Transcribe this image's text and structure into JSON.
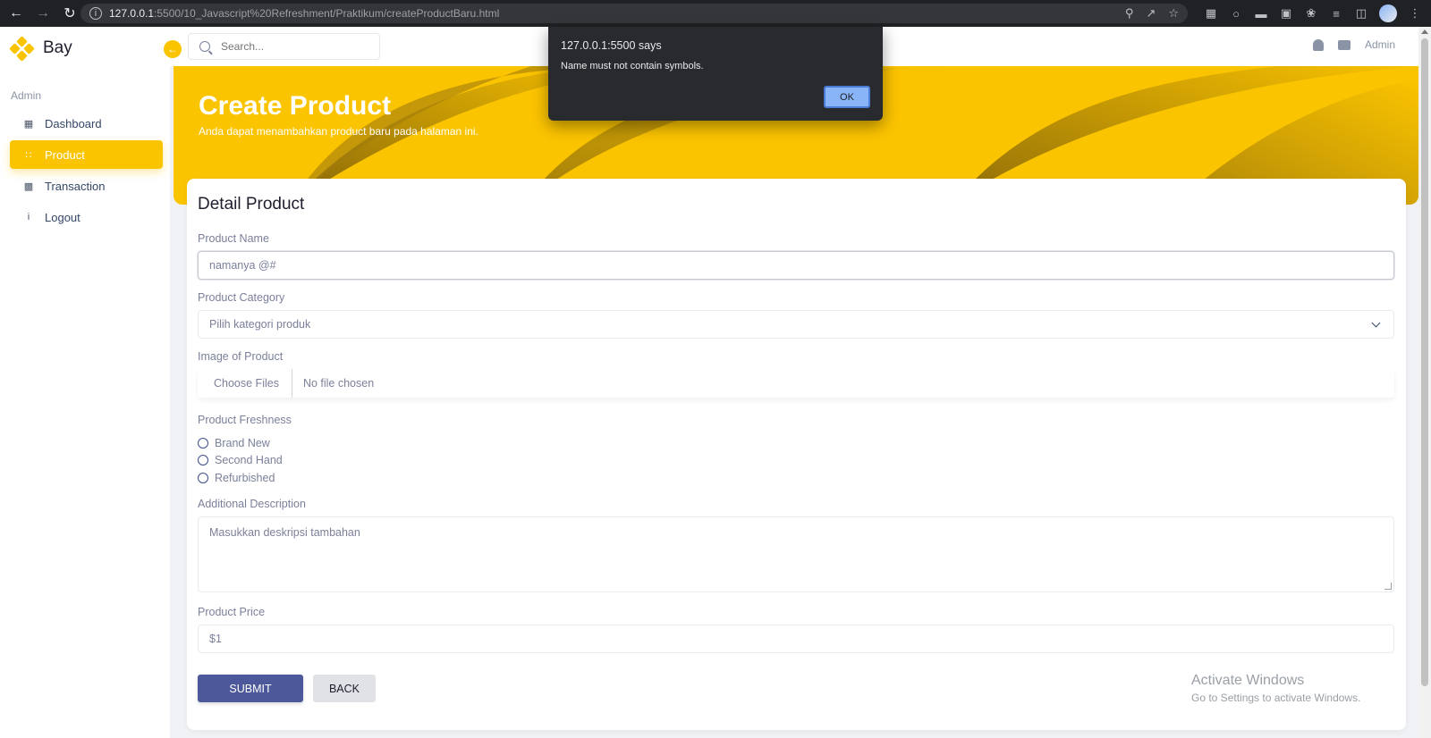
{
  "browser": {
    "url_host": "127.0.0.1",
    "url_rest": ":5500/10_Javascript%20Refreshment/Praktikum/createProductBaru.html"
  },
  "brand": {
    "name": "Bay"
  },
  "sidebar": {
    "section": "Admin",
    "items": [
      {
        "label": "Dashboard",
        "icon": "grid-icon"
      },
      {
        "label": "Product",
        "icon": "product-icon",
        "active": true
      },
      {
        "label": "Transaction",
        "icon": "wallet-icon"
      },
      {
        "label": "Logout",
        "icon": "info-icon"
      }
    ]
  },
  "topbar": {
    "search_placeholder": "Search...",
    "user": "Admin"
  },
  "hero": {
    "title": "Create Product",
    "subtitle": "Anda dapat menambahkan product baru pada halaman ini."
  },
  "form": {
    "title": "Detail Product",
    "name_label": "Product Name",
    "name_value": "namanya @#",
    "category_label": "Product Category",
    "category_value": "Pilih kategori produk",
    "image_label": "Image of Product",
    "file_button": "Choose Files",
    "file_status": "No file chosen",
    "freshness_label": "Product Freshness",
    "freshness_options": [
      "Brand New",
      "Second Hand",
      "Refurbished"
    ],
    "description_label": "Additional Description",
    "description_placeholder": "Masukkan deskripsi tambahan",
    "price_label": "Product Price",
    "price_value": "$1",
    "submit": "SUBMIT",
    "back": "BACK"
  },
  "dialog": {
    "origin": "127.0.0.1:5500 says",
    "message": "Name must not contain symbols.",
    "ok": "OK"
  },
  "watermark": {
    "line1": "Activate Windows",
    "line2": "Go to Settings to activate Windows."
  },
  "colors": {
    "accent": "#fbc400",
    "primary_button": "#4c5899"
  }
}
